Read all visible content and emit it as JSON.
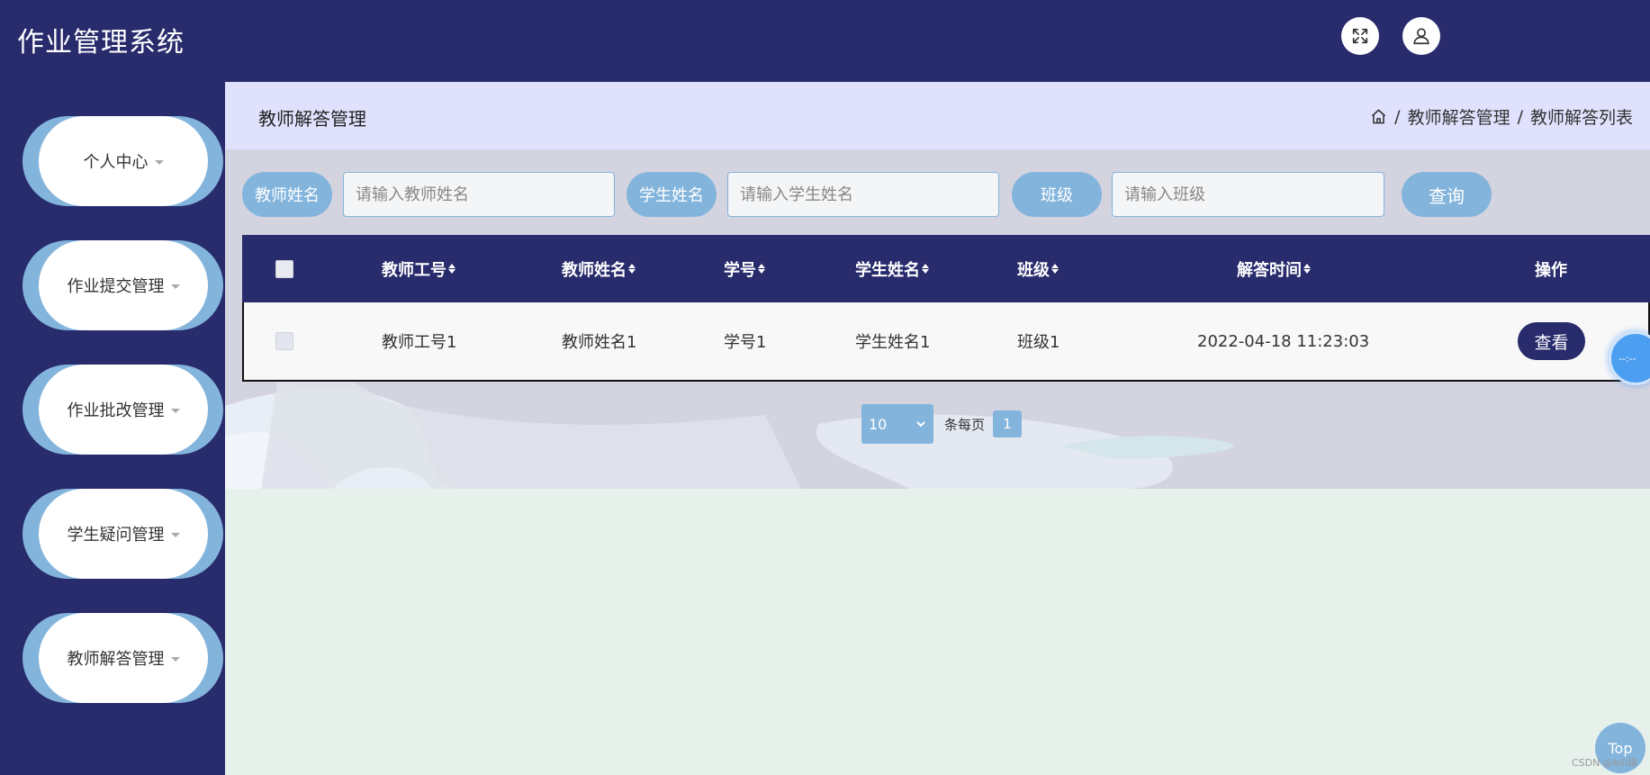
{
  "header": {
    "title": "作业管理系统",
    "fullscreen_icon": "expand-arrows-icon",
    "user_icon": "user-icon"
  },
  "sidebar": {
    "items": [
      {
        "label": "个人中心"
      },
      {
        "label": "作业提交管理"
      },
      {
        "label": "作业批改管理"
      },
      {
        "label": "学生疑问管理"
      },
      {
        "label": "教师解答管理"
      }
    ]
  },
  "page": {
    "title": "教师解答管理",
    "breadcrumb": {
      "home_icon": "home-icon",
      "sep1": "/",
      "item1": "教师解答管理",
      "sep2": "/",
      "item2": "教师解答列表"
    }
  },
  "search": {
    "teacher_name_label": "教师姓名",
    "teacher_name_placeholder": "请输入教师姓名",
    "student_name_label": "学生姓名",
    "student_name_placeholder": "请输入学生姓名",
    "class_label": "班级",
    "class_placeholder": "请输入班级",
    "query_button": "查询"
  },
  "table": {
    "headers": {
      "teacher_id": "教师工号",
      "teacher_name": "教师姓名",
      "student_id": "学号",
      "student_name": "学生姓名",
      "class": "班级",
      "answer_time": "解答时间",
      "actions": "操作"
    },
    "rows": [
      {
        "teacher_id": "教师工号1",
        "teacher_name": "教师姓名1",
        "student_id": "学号1",
        "student_name": "学生姓名1",
        "class": "班级1",
        "answer_time": "2022-04-18 11:23:03",
        "view_button": "查看"
      }
    ]
  },
  "pagination": {
    "page_size": "10",
    "per_page_label": "条每页",
    "current_page": "1"
  },
  "widgets": {
    "clock_text": "--:--",
    "top_button": "Top",
    "watermark": "CSDN @bill球"
  },
  "colors": {
    "primary_dark": "#282b6c",
    "accent_blue": "#83b4dc",
    "title_bar_bg": "#e0e1fd",
    "page_bg": "#e6f1ec"
  }
}
